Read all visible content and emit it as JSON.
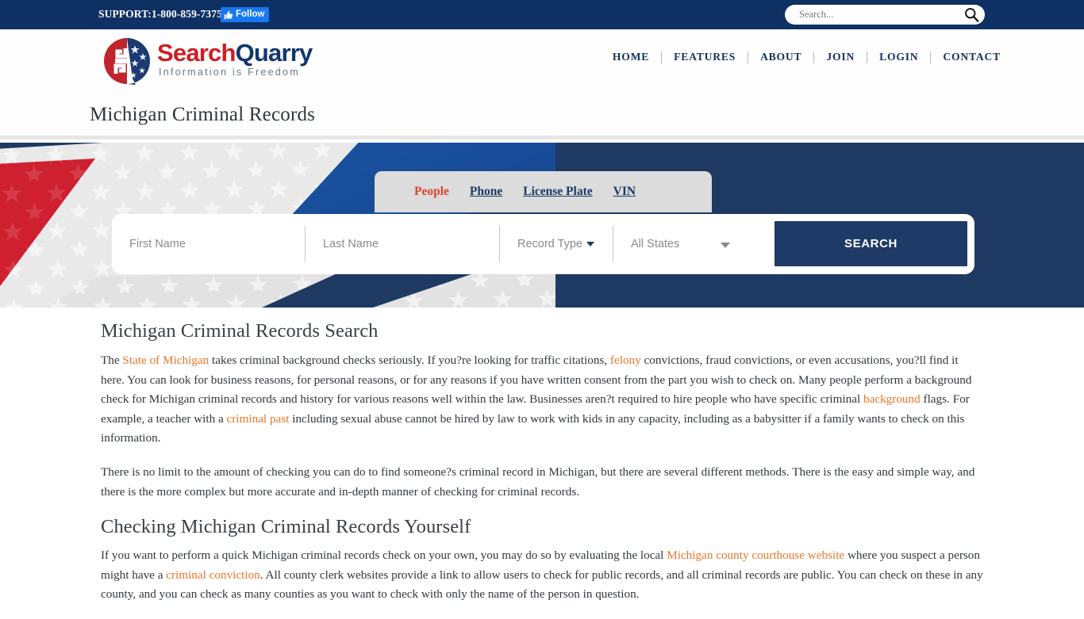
{
  "topbar": {
    "support": "SUPPORT:1-800-859-7375",
    "follow_label": "Follow",
    "follow_icon": "thumbs-up-icon",
    "search_placeholder": "Search...",
    "search_value": "",
    "search_icon": "search-icon",
    "bg_color": "#0e3063",
    "follow_color": "#1877f2"
  },
  "header": {
    "logo": {
      "name_part1": "Search",
      "name_part2": "Quarry",
      "tagline": "Information is Freedom",
      "color_red": "#cd1f26",
      "color_blue": "#12376e"
    },
    "nav": [
      {
        "label": "HOME"
      },
      {
        "label": "FEATURES"
      },
      {
        "label": "ABOUT"
      },
      {
        "label": "JOIN"
      },
      {
        "label": "LOGIN"
      },
      {
        "label": "CONTACT"
      }
    ],
    "page_title": "Michigan Criminal Records"
  },
  "hero": {
    "bg_color": "#1e3a63",
    "tabs": [
      {
        "label": "People",
        "active": true
      },
      {
        "label": "Phone",
        "active": false
      },
      {
        "label": "License Plate",
        "active": false
      },
      {
        "label": "VIN",
        "active": false
      }
    ],
    "form": {
      "first_name_placeholder": "First Name",
      "first_name_value": "",
      "last_name_placeholder": "Last Name",
      "last_name_value": "",
      "record_type_label": "Record Type",
      "state_label": "All States",
      "search_button": "SEARCH",
      "button_color": "#1e3a66"
    }
  },
  "content": {
    "heading1": "Michigan Criminal Records Search",
    "p1": {
      "t1": "The ",
      "l1": "State of Michigan",
      "t2": " takes criminal background checks seriously. If you?re looking for traffic citations, ",
      "l2": "felony",
      "t3": " convictions, fraud convictions, or even accusations, you?ll find it here. You can look for business reasons, for personal reasons, or for any reasons if you have written consent from the part you wish to check on. Many people perform a background check for Michigan criminal records and history for various reasons well within the law. Businesses aren?t required to hire people who have specific criminal ",
      "l3": "background",
      "t4": " flags. For example, a teacher with a ",
      "l4": "criminal past",
      "t5": " including sexual abuse cannot be hired by law to work with kids in any capacity, including as a babysitter if a family wants to check on this information."
    },
    "p2": "There is no limit to the amount of checking you can do to find someone?s criminal record in Michigan, but there are several different methods. There is the easy and simple way, and there is the more complex but more accurate and in-depth manner of checking for criminal records.",
    "heading2": "Checking Michigan Criminal Records Yourself",
    "p3": {
      "t1": "If you want to perform a quick Michigan criminal records check on your own, you may do so by evaluating the local ",
      "l1": "Michigan county courthouse website",
      "t2": " where you suspect a person might have a ",
      "l2": "criminal conviction",
      "t3": ". All county clerk websites provide a link to allow users to check for public records, and all criminal records are public. You can check on these in any county, and you can check as many counties as you want to check with only the name of the person in question."
    },
    "link_color": "#ea7628"
  }
}
